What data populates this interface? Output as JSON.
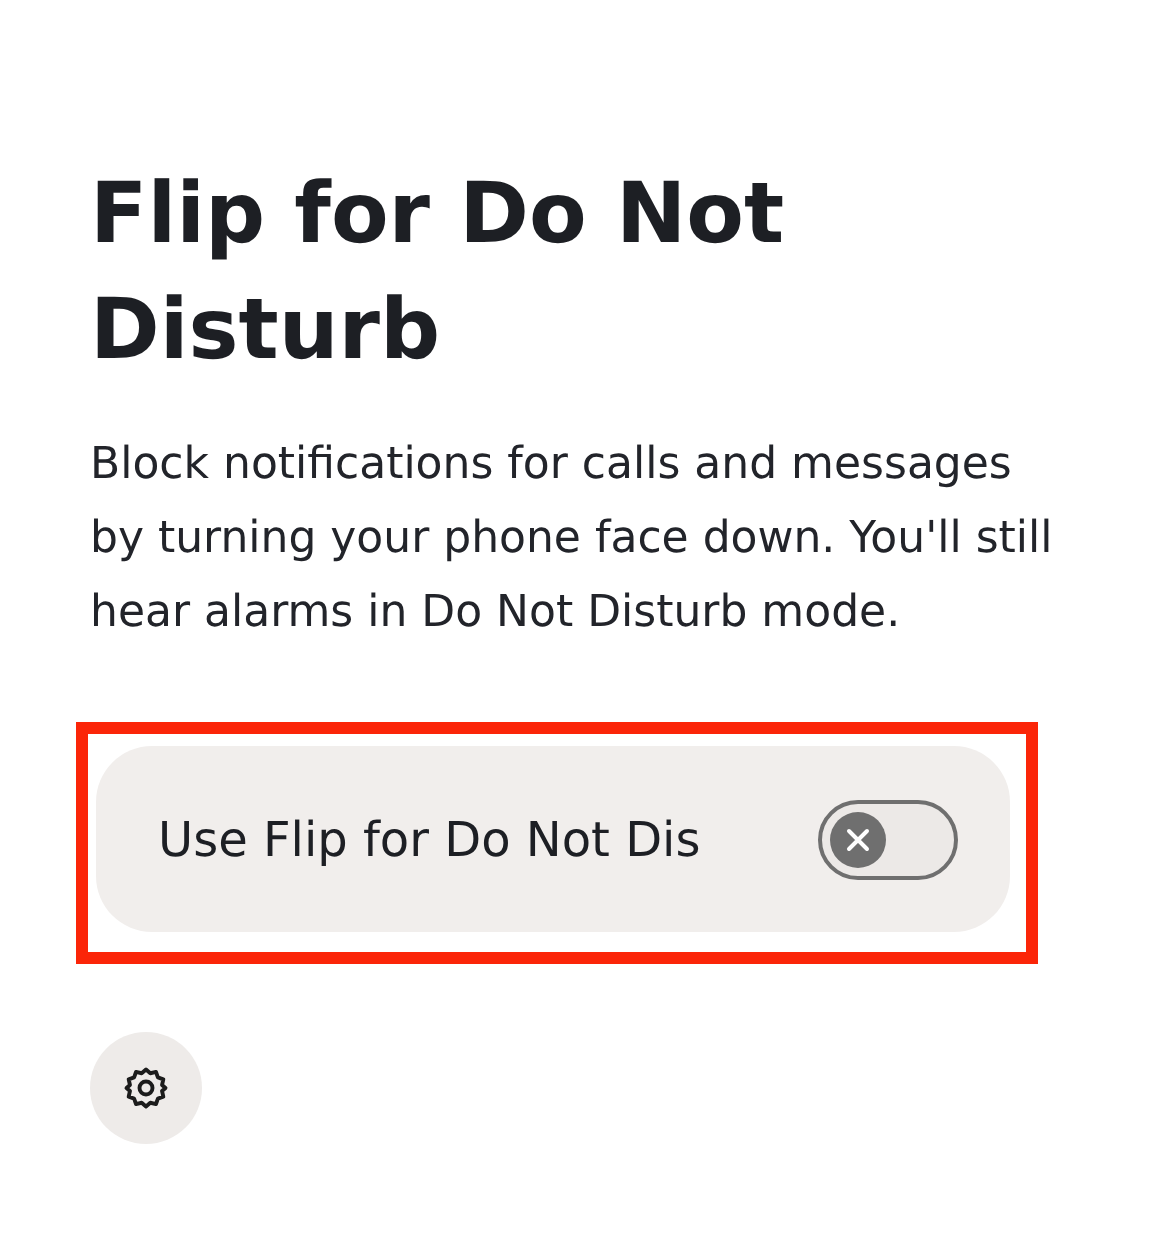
{
  "title": "Flip for Do Not Disturb",
  "description": "Block notifications for calls and messages by turning your phone face down. You'll still hear alarms in Do Not Disturb mode.",
  "main_switch": {
    "label": "Use Flip for Do Not Dis",
    "on": false,
    "highlighted": true
  }
}
